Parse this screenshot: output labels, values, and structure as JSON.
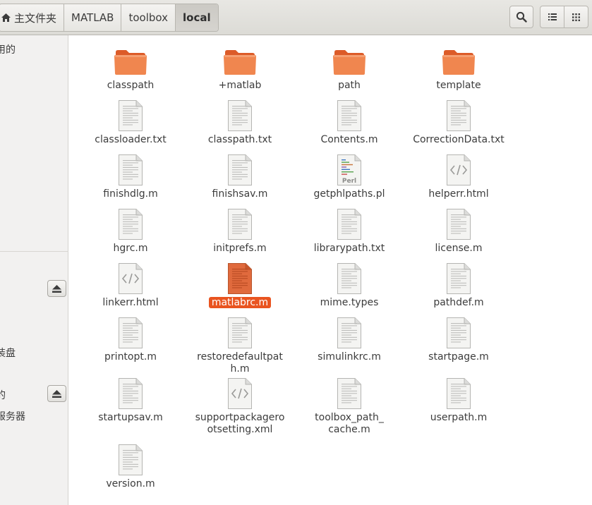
{
  "header": {
    "breadcrumbs": [
      {
        "label": "主文件夹",
        "active": false
      },
      {
        "label": "MATLAB",
        "active": false
      },
      {
        "label": "toolbox",
        "active": false
      },
      {
        "label": "local",
        "active": true
      }
    ],
    "icons": {
      "home": "home-icon",
      "search": "search-icon",
      "list_view": "list-view-icon",
      "grid_view": "grid-view-icon"
    }
  },
  "sidebar": {
    "items": [
      "用的",
      "装盘",
      "的",
      "服务器"
    ]
  },
  "colors": {
    "accent": "#e95420",
    "folder": "#f0864f",
    "folder_dark": "#dc5b28"
  },
  "files": [
    {
      "name": "classpath",
      "kind": "folder"
    },
    {
      "name": "+matlab",
      "kind": "folder"
    },
    {
      "name": "path",
      "kind": "folder"
    },
    {
      "name": "template",
      "kind": "folder"
    },
    {
      "name": "classloader.txt",
      "kind": "text"
    },
    {
      "name": "classpath.txt",
      "kind": "text"
    },
    {
      "name": "Contents.m",
      "kind": "text"
    },
    {
      "name": "CorrectionData.txt",
      "kind": "text"
    },
    {
      "name": "finishdlg.m",
      "kind": "text"
    },
    {
      "name": "finishsav.m",
      "kind": "text"
    },
    {
      "name": "getphlpaths.pl",
      "kind": "perl"
    },
    {
      "name": "helperr.html",
      "kind": "html"
    },
    {
      "name": "hgrc.m",
      "kind": "text"
    },
    {
      "name": "initprefs.m",
      "kind": "text"
    },
    {
      "name": "librarypath.txt",
      "kind": "text"
    },
    {
      "name": "license.m",
      "kind": "text"
    },
    {
      "name": "linkerr.html",
      "kind": "html"
    },
    {
      "name": "matlabrc.m",
      "kind": "text",
      "selected": true
    },
    {
      "name": "mime.types",
      "kind": "text"
    },
    {
      "name": "pathdef.m",
      "kind": "text"
    },
    {
      "name": "printopt.m",
      "kind": "text"
    },
    {
      "name": "restoredefaultpat\nh.m",
      "kind": "text"
    },
    {
      "name": "simulinkrc.m",
      "kind": "text"
    },
    {
      "name": "startpage.m",
      "kind": "text"
    },
    {
      "name": "startupsav.m",
      "kind": "text"
    },
    {
      "name": "supportpackagero\notsetting.xml",
      "kind": "html"
    },
    {
      "name": "toolbox_path_\ncache.m",
      "kind": "text"
    },
    {
      "name": "userpath.m",
      "kind": "text"
    },
    {
      "name": "version.m",
      "kind": "text"
    }
  ]
}
